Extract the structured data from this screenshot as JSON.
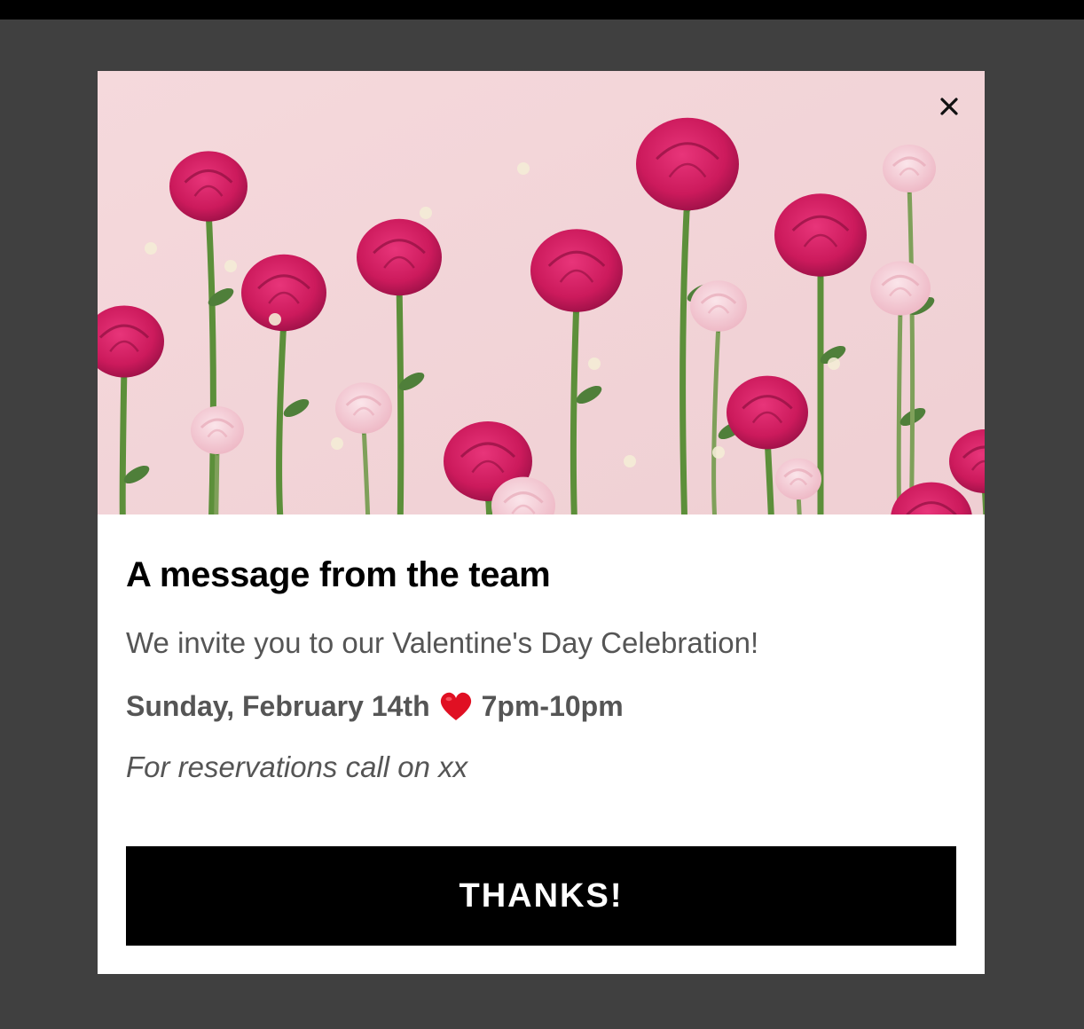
{
  "modal": {
    "close_icon": "close-icon",
    "hero_image": "pink-roses-photo",
    "title": "A message from the team",
    "invite_text": "We invite you to our Valentine's Day Celebration!",
    "date_text": "Sunday, February 14th",
    "heart_icon": "heart-icon",
    "time_text": "7pm-10pm",
    "reservation_text": "For reservations call on xx",
    "button_label": "THANKS!"
  },
  "colors": {
    "backdrop": "#404040",
    "button_bg": "#000000",
    "button_text": "#ffffff",
    "body_text": "#555555",
    "rose": "#d21f62",
    "hero_bg": "#f3d4d8"
  }
}
